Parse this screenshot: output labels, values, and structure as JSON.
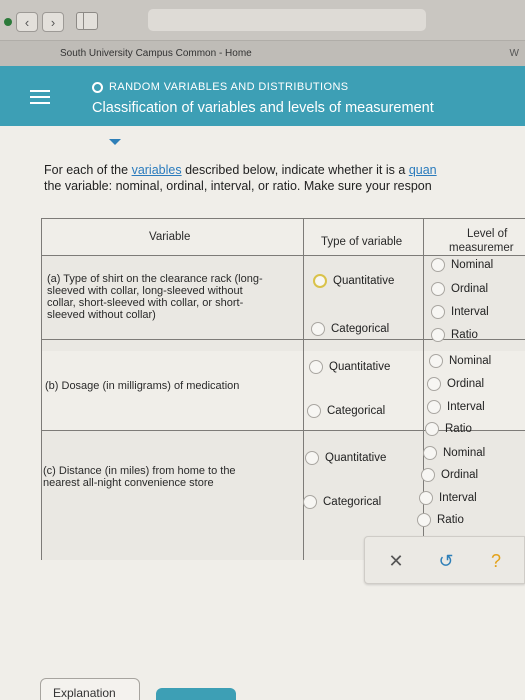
{
  "tab_title": "South University Campus Common - Home",
  "tab_extra": "W",
  "header": {
    "topic": "RANDOM VARIABLES AND DISTRIBUTIONS",
    "title": "Classification of variables and levels of measurement"
  },
  "instructions": {
    "line1_pre": "For each of the ",
    "line1_link": "variables",
    "line1_post": " described below, indicate whether it is a ",
    "line1_link2": "quan",
    "line2": "the variable: nominal, ordinal, interval, or ratio. Make sure your respon"
  },
  "table": {
    "headers": {
      "variable": "Variable",
      "type": "Type of variable",
      "level_line1": "Level of",
      "level_line2": "measuremer"
    },
    "rows": [
      {
        "variable_lines": [
          "(a) Type of shirt on the clearance rack (long-",
          "sleeved with collar, long-sleeved without",
          "collar, short-sleeved with collar, or short-",
          "sleeved without collar)"
        ],
        "type_options": [
          "Quantitative",
          "Categorical"
        ],
        "level_options": [
          "Nominal",
          "Ordinal",
          "Interval",
          "Ratio"
        ]
      },
      {
        "variable_lines": [
          "(b) Dosage (in milligrams) of medication"
        ],
        "type_options": [
          "Quantitative",
          "Categorical"
        ],
        "level_options": [
          "Nominal",
          "Ordinal",
          "Interval",
          "Ratio"
        ]
      },
      {
        "variable_lines": [
          "(c) Distance (in miles) from home to the",
          "nearest all-night convenience store"
        ],
        "type_options": [
          "Quantitative",
          "Categorical"
        ],
        "level_options": [
          "Nominal",
          "Ordinal",
          "Interval",
          "Ratio"
        ]
      }
    ]
  },
  "toolbar": {
    "clear": "✕",
    "undo": "↺",
    "help": "?"
  },
  "footer": {
    "explanation": "Explanation"
  },
  "colors": {
    "header_bg": "#3d9fb5",
    "link": "#2a7bbd",
    "selected_radio": "#d9c24a",
    "undo": "#2e7fb8",
    "help": "#e3a21a"
  }
}
